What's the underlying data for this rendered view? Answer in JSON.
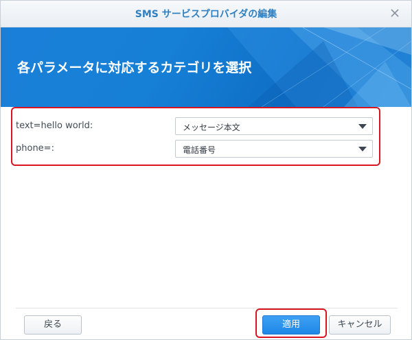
{
  "dialog": {
    "title": "SMS サービスプロバイダの編集",
    "close_icon": "close-icon"
  },
  "banner": {
    "heading": "各パラメータに対応するカテゴリを選択"
  },
  "parameters": [
    {
      "label": "text=hello world:",
      "selected": "メッセージ本文"
    },
    {
      "label": "phone=:",
      "selected": "電話番号"
    }
  ],
  "buttons": {
    "back": "戻る",
    "apply": "適用",
    "cancel": "キャンセル"
  },
  "colors": {
    "accent": "#1a7fd8",
    "highlight": "#d8141e",
    "title_text": "#2f7fc1"
  }
}
